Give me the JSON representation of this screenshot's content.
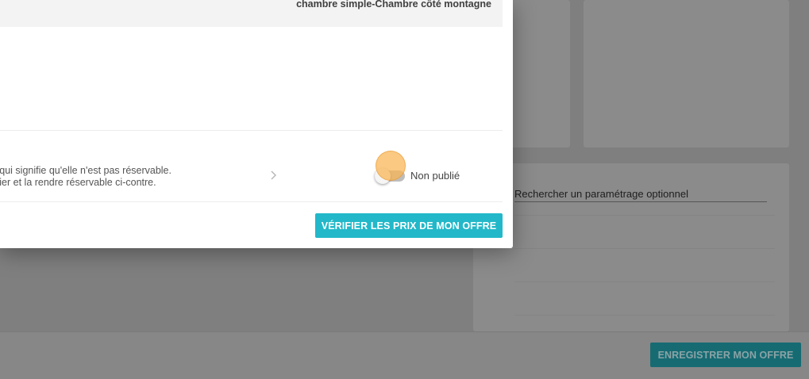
{
  "modal": {
    "room_name": "chambre simple-Chambre côté montagne",
    "status_line_1": "qui signifie qu'elle n'est pas réservable.",
    "status_line_2": "ier et la rendre réservable ci-contre.",
    "toggle_label": "Non publié",
    "toggle_on": false,
    "verify_button_label": "VÉRIFIER LES PRIX DE MON OFFRE"
  },
  "background": {
    "search_placeholder": "Rechercher un paramétrage optionnel",
    "save_button_label": "ENREGISTRER MON OFFRE"
  },
  "colors": {
    "accent": "#22b8c9",
    "accent_dimmed": "#166b73",
    "overlay": "#7f7f7f"
  },
  "icons": {
    "chevron": "chevron-right-icon"
  }
}
